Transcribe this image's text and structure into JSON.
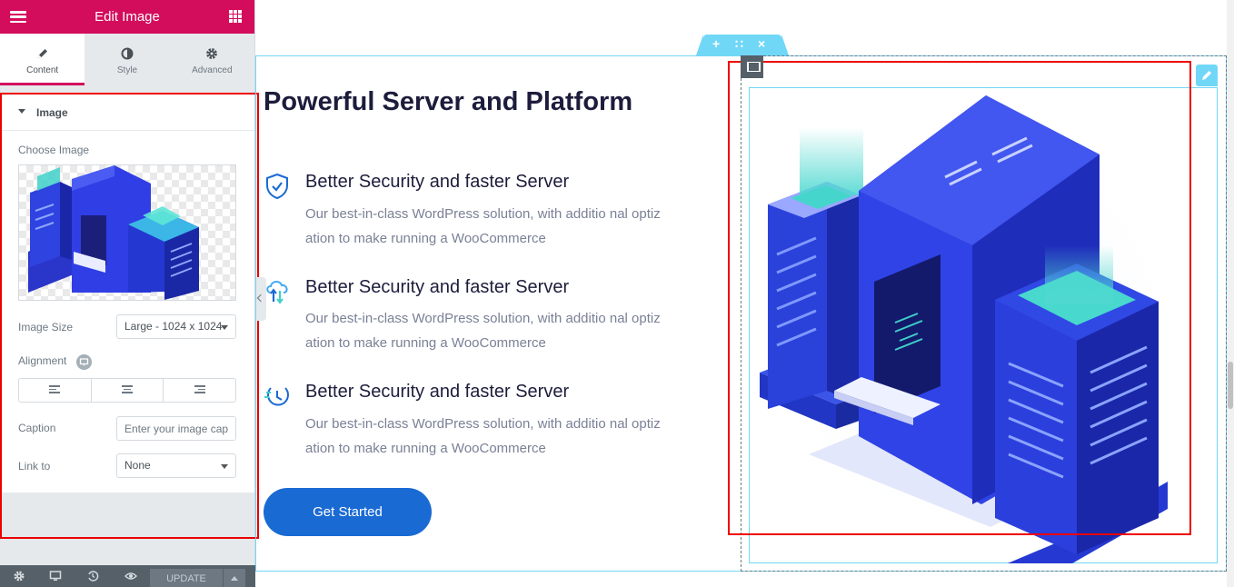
{
  "panel": {
    "title": "Edit Image",
    "tabs": [
      {
        "label": "Content",
        "icon": "pencil-icon",
        "active": true
      },
      {
        "label": "Style",
        "icon": "half-circle-icon",
        "active": false
      },
      {
        "label": "Advanced",
        "icon": "gear-icon",
        "active": false
      }
    ],
    "section_title": "Image",
    "choose_image_label": "Choose Image",
    "image_size_label": "Image Size",
    "image_size_value": "Large - 1024 x 1024",
    "alignment_label": "Alignment",
    "caption_label": "Caption",
    "caption_placeholder": "Enter your image caption",
    "link_label": "Link to",
    "link_value": "None",
    "footer": {
      "update_label": "UPDATE"
    },
    "accent": "#d30c5c"
  },
  "preview": {
    "heading": "Powerful Server and Platform",
    "features": [
      {
        "icon": "shield-check-icon",
        "title": "Better Security and faster Server",
        "desc_line1": "Our best-in-class WordPress solution, with additio nal optiz",
        "desc_line2": "ation to make running a WooCommerce"
      },
      {
        "icon": "cloud-transfer-icon",
        "title": "Better Security and faster Server",
        "desc_line1": "Our best-in-class WordPress solution, with additio nal optiz",
        "desc_line2": "ation to make running a WooCommerce"
      },
      {
        "icon": "clock-speed-icon",
        "title": "Better Security and faster Server",
        "desc_line1": "Our best-in-class WordPress solution, with additio nal optiz",
        "desc_line2": "ation to make running a WooCommerce"
      }
    ],
    "cta_label": "Get Started",
    "cta_color": "#1a6ad4",
    "section_tools": {
      "add": "+",
      "move": "∷",
      "close": "×"
    }
  }
}
